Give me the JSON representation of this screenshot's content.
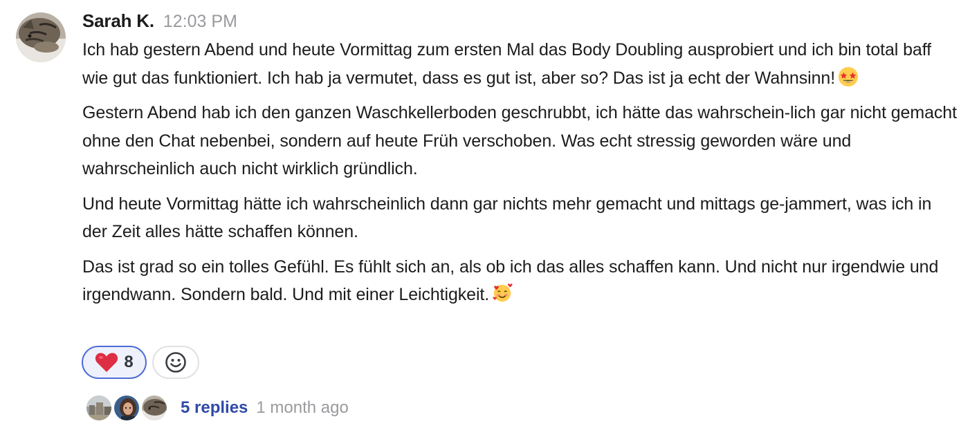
{
  "message": {
    "author": "Sarah K.",
    "timestamp": "12:03 PM",
    "paragraphs": [
      "Ich hab gestern Abend und heute Vormittag zum ersten Mal das Body Doubling ausprobiert und ich bin total baff wie gut das funktioniert. Ich hab ja vermutet, dass es gut ist, aber so? Das ist ja echt der Wahnsinn!",
      "Gestern Abend hab ich den ganzen Waschkellerboden geschrubbt, ich hätte das wahrschein-lich gar nicht gemacht ohne den Chat nebenbei, sondern auf heute Früh verschoben. Was echt stressig geworden wäre und wahrscheinlich auch nicht wirklich gründlich.",
      "Und heute Vormittag hätte ich wahrscheinlich dann gar nichts mehr gemacht und mittags ge-jammert, was ich in der Zeit alles hätte schaffen können.",
      "Das ist grad so ein tolles Gefühl. Es fühlt sich an, als ob ich das alles schaffen kann. Und nicht nur irgendwie und irgendwann. Sondern bald. Und mit einer Leichtigkeit."
    ],
    "emojis": [
      "star-struck-emoji",
      "smiling-face-with-hearts-emoji"
    ]
  },
  "reactions": [
    {
      "icon": "red-heart-emoji",
      "count": "8",
      "active": true
    }
  ],
  "add_reaction_icon": "smiley-add-icon",
  "thread": {
    "replies_label": "5 replies",
    "last_reply": "1 month ago"
  },
  "colors": {
    "accent": "#4d6bd6",
    "link": "#2f4aa8",
    "muted": "#9a9a9e",
    "text": "#1d1c1d"
  }
}
